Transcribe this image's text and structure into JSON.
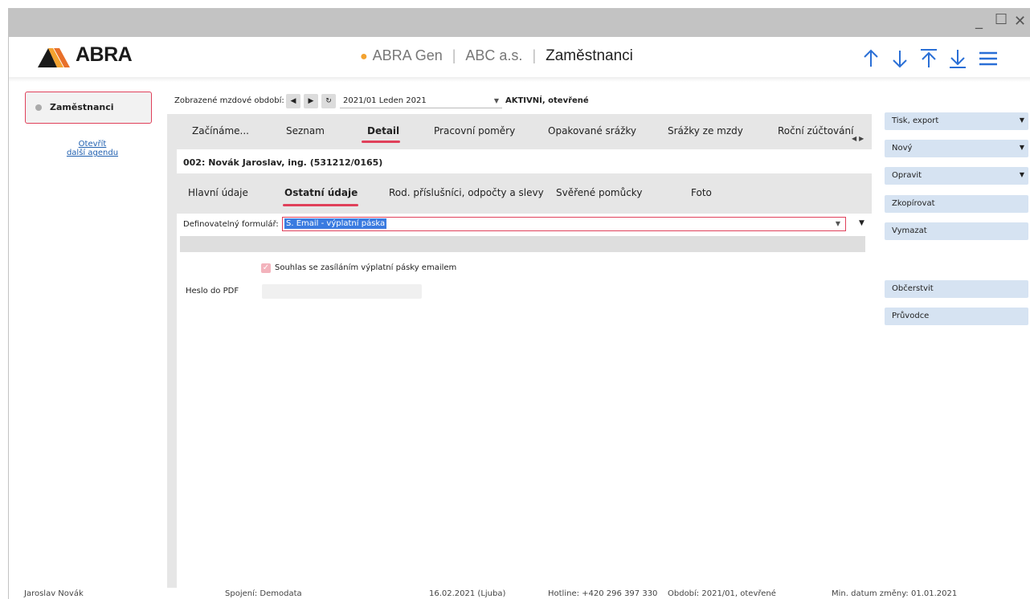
{
  "window": {
    "minimize_icon": "minimize-icon",
    "maximize_icon": "maximize-icon",
    "close_icon": "close-icon"
  },
  "appbar": {
    "logo_text": "ABRA",
    "product": "ABRA Gen",
    "company": "ABC a.s.",
    "agenda": "Zaměstnanci",
    "accent_color": "#f3a22f",
    "icons": [
      "arrow-up-icon",
      "arrow-down-icon",
      "arrow-first-icon",
      "arrow-last-icon",
      "menu-icon"
    ]
  },
  "left_panel": {
    "agenda_button": "Zaměstnanci",
    "open_link_line1": "Otevřít",
    "open_link_line2": "další agendu"
  },
  "period": {
    "label": "Zobrazené mzdové období:",
    "value": "2021/01 Leden 2021",
    "status": "AKTIVNÍ, otevřené"
  },
  "main_tabs": [
    {
      "label": "Začínáme..."
    },
    {
      "label": "Seznam"
    },
    {
      "label": "Detail",
      "active": true
    },
    {
      "label": "Pracovní poměry"
    },
    {
      "label": "Opakované srážky"
    },
    {
      "label": "Srážky ze mzdy"
    },
    {
      "label": "Roční zúčtování"
    }
  ],
  "employee": {
    "title": "002: Novák Jaroslav, ing. (531212/0165)"
  },
  "sub_tabs": [
    {
      "label": "Hlavní údaje"
    },
    {
      "label": "Ostatní údaje",
      "active": true
    },
    {
      "label": "Rod. příslušníci, odpočty a slevy"
    },
    {
      "label": "Svěřené pomůcky"
    },
    {
      "label": "Foto"
    }
  ],
  "form": {
    "definable_form_label": "Definovatelný formulář:",
    "definable_form_value": "S. Email - výplatní páska",
    "consent_label": "Souhlas se zasíláním výplatní pásky emailem",
    "consent_checked": true,
    "pdf_password_label": "Heslo do PDF",
    "pdf_password_value": ""
  },
  "actions": [
    {
      "label": "Tisk, export",
      "dropdown": true
    },
    {
      "label": "Nový",
      "dropdown": true
    },
    {
      "label": "Opravit",
      "dropdown": true
    },
    {
      "label": "Zkopírovat",
      "dropdown": false
    },
    {
      "label": "Vymazat",
      "dropdown": false
    },
    {
      "label": "Občerstvit",
      "dropdown": false
    },
    {
      "label": "Průvodce",
      "dropdown": false
    }
  ],
  "statusbar": {
    "user": "Jaroslav Novák",
    "connection": "Spojení: Demodata",
    "date": "16.02.2021 (Ljuba)",
    "hotline": "Hotline: +420 296 397 330",
    "period": "Období: 2021/01, otevřené",
    "min_date": "Min. datum změny: 01.01.2021"
  },
  "colors": {
    "highlight": "#e0405a",
    "action_bg": "#d6e3f2",
    "nav_icon": "#2a6fd6"
  }
}
